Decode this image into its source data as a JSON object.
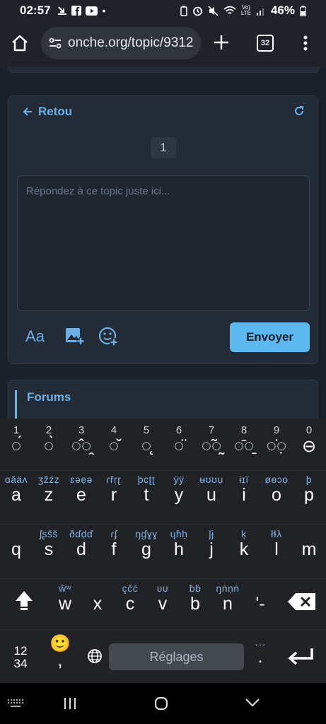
{
  "status": {
    "time": "02:57",
    "battery": "46%"
  },
  "browser": {
    "url": "onche.org/topic/9312",
    "tab_count": "32"
  },
  "reply": {
    "back_label": "Retou",
    "page_number": "1",
    "placeholder": "Répondez à ce topic juste ici...",
    "send_label": "Envoyer",
    "font_tool_label": "Aa"
  },
  "forums": {
    "title": "Forums"
  },
  "keyboard": {
    "numbers": [
      "1",
      "2",
      "3",
      "4",
      "5",
      "6",
      "7",
      "8",
      "9",
      "0"
    ],
    "diacritics": [
      "◌́",
      "◌̀",
      "◌̂◌̭",
      "◌̌",
      "◌̨",
      "◌̈",
      "◌̃◌̰",
      "◌̄◌̱",
      "◌̇◌̣",
      "⊖"
    ],
    "row1_hints": [
      "ɑǎäʌ",
      "ʒžźẓ",
      "ɛəẹə",
      "ɾřṛɽ",
      "þcʈʈ",
      "ÿÿ",
      "ʉʊʊụ",
      "ɨɪï",
      "øɵɔọ",
      "þ"
    ],
    "row1": [
      "a",
      "z",
      "e",
      "r",
      "t",
      "y",
      "u",
      "i",
      "o",
      "p"
    ],
    "row2_hints": [
      "ʃʂšš",
      "ðɗḍď",
      "ɾʄ",
      "ŋɠɣɣ",
      "ɥɦḥ",
      "ǰɉ",
      "ķ",
      "łɬλ"
    ],
    "row2": [
      "q",
      "s",
      "d",
      "f",
      "g",
      "h",
      "j",
      "k",
      "l",
      "m"
    ],
    "row3_hints": [
      "ŵʷ",
      "çčć",
      "ʋʋ",
      "ƀḃ",
      "ŋṅṇṅ"
    ],
    "row3": [
      "w",
      "x",
      "c",
      "v",
      "b",
      "n",
      "'-"
    ],
    "mode_label": "12\n34",
    "comma": ",",
    "period": ".",
    "period_hint": "…",
    "space_label": "Réglages"
  }
}
